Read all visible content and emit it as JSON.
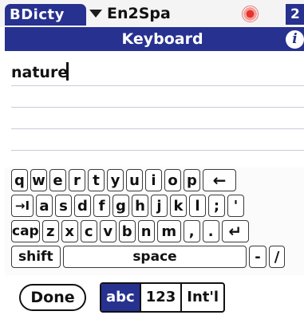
{
  "app": {
    "name": "BDicty"
  },
  "language": {
    "selected": "En2Spa"
  },
  "corner": {
    "value": "2"
  },
  "title": {
    "text": "Keyboard",
    "info_glyph": "i"
  },
  "input": {
    "value": "nature"
  },
  "keyboard": {
    "row1": [
      "q",
      "w",
      "e",
      "r",
      "t",
      "y",
      "u",
      "i",
      "o",
      "p",
      "←"
    ],
    "row2": [
      "→I",
      "a",
      "s",
      "d",
      "f",
      "g",
      "h",
      "j",
      "k",
      "l",
      ";",
      "'"
    ],
    "row3": [
      "cap",
      "z",
      "x",
      "c",
      "v",
      "b",
      "n",
      "m",
      ",",
      ".",
      "↵"
    ],
    "row4": [
      "shift",
      "space",
      "-",
      "/"
    ]
  },
  "bottom": {
    "done": "Done",
    "modes": [
      "abc",
      "123",
      "Int'l"
    ],
    "active_mode": "abc"
  },
  "colors": {
    "accent": "#27318f",
    "indicator": "#e8322a"
  }
}
